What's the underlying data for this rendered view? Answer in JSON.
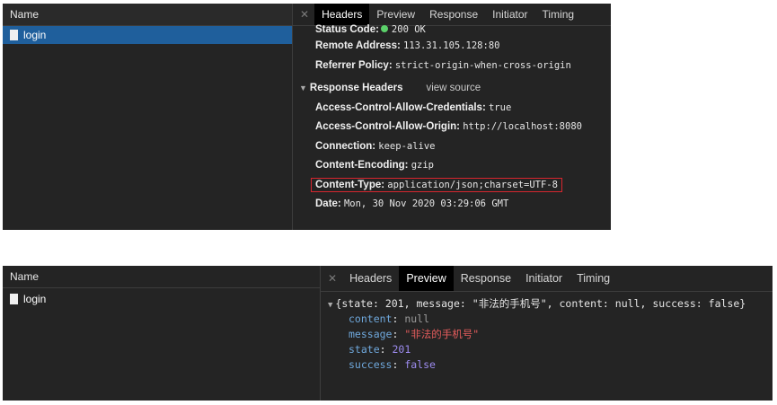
{
  "top": {
    "name_header": "Name",
    "request": "login",
    "tabs": [
      "Headers",
      "Preview",
      "Response",
      "Initiator",
      "Timing"
    ],
    "active_tab": "Headers",
    "general": [
      {
        "key": "Status Code:",
        "value": "200 OK",
        "status_color": "#5bd16a"
      },
      {
        "key": "Remote Address:",
        "value": "113.31.105.128:80"
      },
      {
        "key": "Referrer Policy:",
        "value": "strict-origin-when-cross-origin"
      }
    ],
    "response_headers_title": "Response Headers",
    "view_source": "view source",
    "response_headers": [
      {
        "key": "Access-Control-Allow-Credentials:",
        "value": "true"
      },
      {
        "key": "Access-Control-Allow-Origin:",
        "value": "http://localhost:8080"
      },
      {
        "key": "Connection:",
        "value": "keep-alive"
      },
      {
        "key": "Content-Encoding:",
        "value": "gzip"
      },
      {
        "key": "Content-Type:",
        "value": "application/json;charset=UTF-8",
        "highlighted": true
      },
      {
        "key": "Date:",
        "value": "Mon, 30 Nov 2020 03:29:06 GMT"
      }
    ]
  },
  "bottom": {
    "name_header": "Name",
    "request": "login",
    "tabs": [
      "Headers",
      "Preview",
      "Response",
      "Initiator",
      "Timing"
    ],
    "active_tab": "Preview",
    "summary": {
      "p1": "{state: ",
      "state": "201",
      "p2": ", message: ",
      "message": "\"非法的手机号\"",
      "p3": ", content: ",
      "content": "null",
      "p4": ", success: ",
      "success": "false",
      "p5": "}"
    },
    "fields": [
      {
        "key": "content",
        "value": "null",
        "kind": "null"
      },
      {
        "key": "message",
        "value": "\"非法的手机号\"",
        "kind": "string"
      },
      {
        "key": "state",
        "value": "201",
        "kind": "number"
      },
      {
        "key": "success",
        "value": "false",
        "kind": "bool"
      }
    ]
  },
  "colors": {
    "panel_bg": "#242424",
    "selected_row": "#1f5f9c",
    "highlight_border": "#d7262e"
  }
}
